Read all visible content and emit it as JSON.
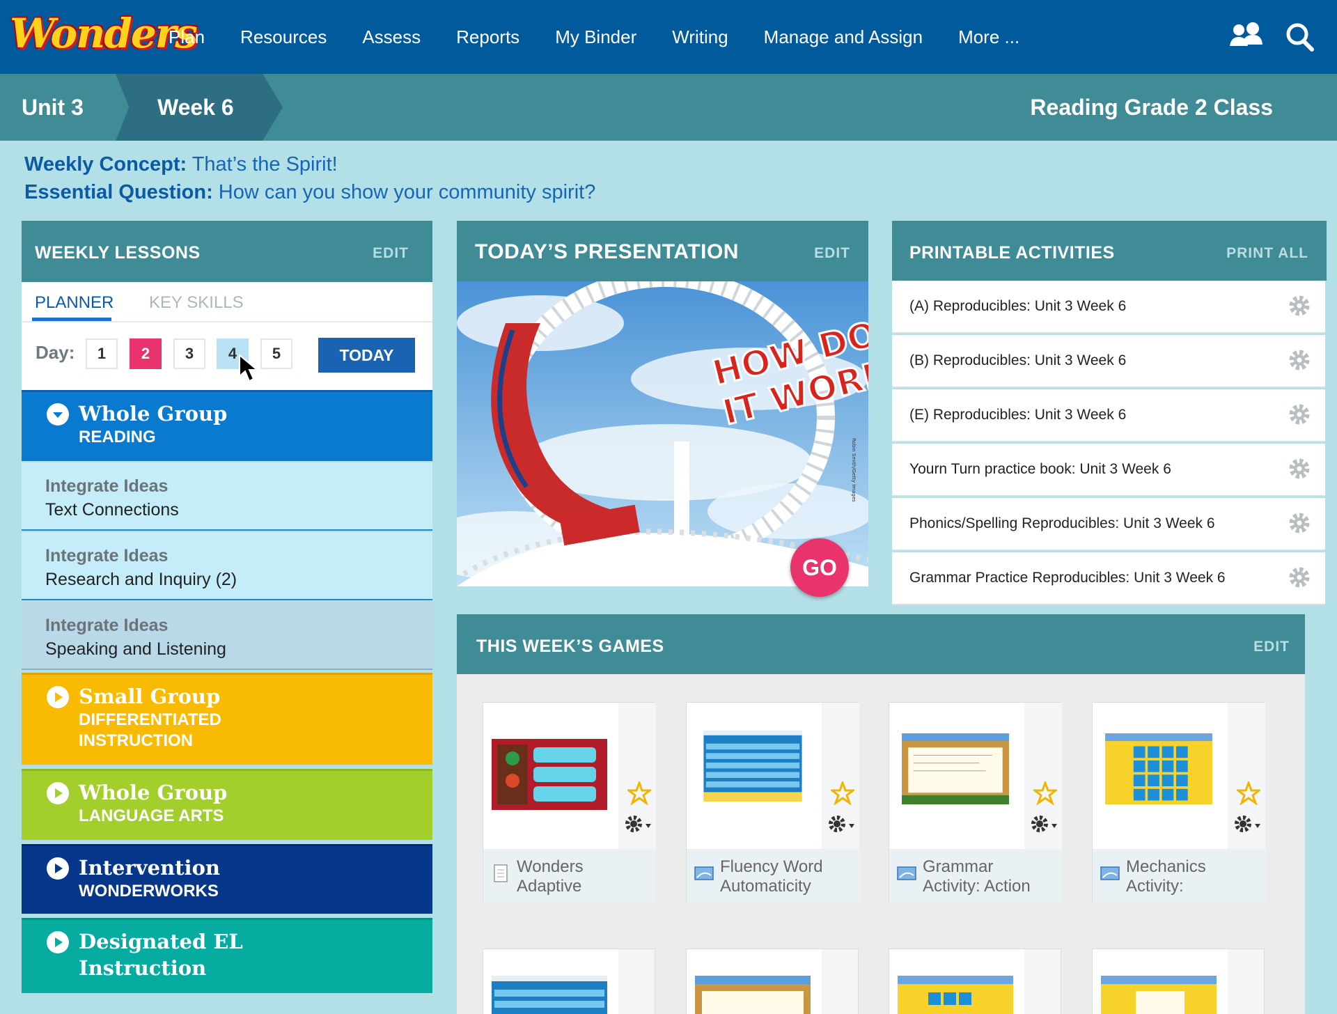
{
  "logo": {
    "text": "Wonders"
  },
  "nav": {
    "items": [
      "Plan",
      "Resources",
      "Assess",
      "Reports",
      "My Binder",
      "Writing",
      "Manage and Assign",
      "More ..."
    ],
    "icons": [
      "users-icon",
      "search-icon"
    ]
  },
  "breadcrumb": {
    "unit": "Unit 3",
    "week": "Week 6",
    "class_name": "Reading Grade 2 Class"
  },
  "concept": {
    "weekly_label": "Weekly Concept:",
    "weekly_value": "That’s the Spirit!",
    "question_label": "Essential Question:",
    "question_value": "How can you show your community spirit?"
  },
  "weekly_lessons": {
    "title": "WEEKLY LESSONS",
    "edit": "EDIT",
    "tabs": [
      "PLANNER",
      "KEY SKILLS"
    ],
    "active_tab": "PLANNER",
    "day_label": "Day:",
    "days": [
      "1",
      "2",
      "3",
      "4",
      "5"
    ],
    "selected_day": "2",
    "hovered_day": "4",
    "today": "TODAY",
    "blocks": [
      {
        "title": "Whole Group",
        "subtitle": "READING",
        "color": "#0a79d0"
      },
      {
        "title": "Small Group",
        "subtitle_1": "DIFFERENTIATED",
        "subtitle_2": "INSTRUCTION",
        "color": "#f8ba02"
      },
      {
        "title": "Whole Group",
        "subtitle": "LANGUAGE ARTS",
        "color": "#a3cf2c"
      },
      {
        "title": "Intervention",
        "subtitle": "WONDERWORKS",
        "color": "#06378a"
      },
      {
        "title_1": "Designated EL",
        "title_2": "Instruction",
        "color": "#06ac9f"
      }
    ],
    "sub_items": [
      {
        "title": "Integrate Ideas",
        "desc": "Text Connections"
      },
      {
        "title": "Integrate Ideas",
        "desc": "Research and Inquiry (2)"
      },
      {
        "title": "Integrate Ideas",
        "desc": "Speaking and Listening"
      }
    ]
  },
  "presentation": {
    "title": "TODAY’S PRESENTATION",
    "edit": "EDIT",
    "image_text_1": "HOW DOES",
    "image_text_2": "IT WORK?",
    "image_credit": "Robin Smith/Getty Images",
    "go": "GO"
  },
  "printables": {
    "title": "PRINTABLE ACTIVITIES",
    "print_all": "PRINT ALL",
    "items": [
      "(A) Reproducibles: Unit 3 Week 6",
      "(B) Reproducibles: Unit 3 Week 6",
      "(E) Reproducibles: Unit 3 Week 6",
      "Yourn Turn practice book: Unit 3 Week 6",
      "Phonics/Spelling Reproducibles: Unit 3 Week 6",
      "Grammar Practice Reproducibles: Unit 3 Week 6"
    ]
  },
  "games": {
    "title": "THIS WEEK’S GAMES",
    "edit": "EDIT",
    "items": [
      {
        "line1": "Wonders",
        "line2": "Adaptive"
      },
      {
        "line1": "Fluency Word",
        "line2": "Automaticity"
      },
      {
        "line1": "Grammar",
        "line2": "Activity: Action"
      },
      {
        "line1": "Mechanics",
        "line2": "Activity:"
      }
    ]
  },
  "colors": {
    "nav_bg": "#005a9c",
    "panel_head": "#3f8c96",
    "page_bg": "#b3dfe6",
    "accent_pink": "#e8336d",
    "today_btn": "#1a63b3"
  }
}
